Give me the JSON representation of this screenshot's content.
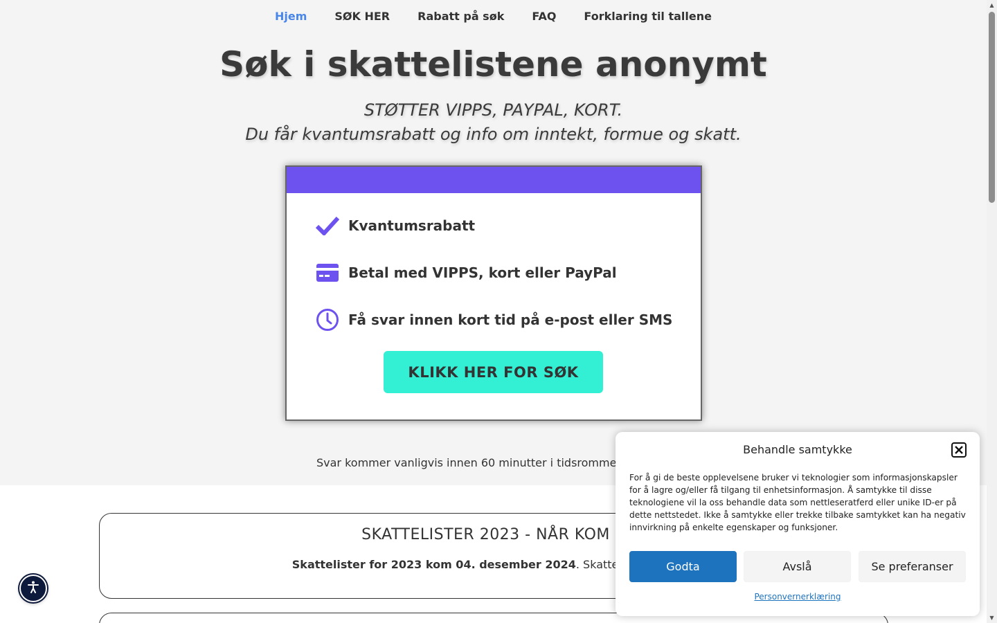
{
  "nav": {
    "items": [
      {
        "label": "Hjem",
        "active": true
      },
      {
        "label": "SØK HER"
      },
      {
        "label": "Rabatt på søk"
      },
      {
        "label": "FAQ"
      },
      {
        "label": "Forklaring til tallene"
      }
    ]
  },
  "hero": {
    "title": "Søk i skattelistene anonymt",
    "subtitle_line1": "STØTTER VIPPS, PAYPAL, KORT.",
    "subtitle_line2": "Du får kvantumsrabatt og info om inntekt, formue og skatt."
  },
  "card": {
    "accent_color": "#6d52ef",
    "features": [
      {
        "icon": "checkmark-icon",
        "label": "Kvantumsrabatt"
      },
      {
        "icon": "credit-card-icon",
        "label": "Betal med VIPPS, kort eller PayPal"
      },
      {
        "icon": "clock-icon",
        "label": "Få svar innen kort tid på e-post eller SMS"
      }
    ],
    "cta_label": "KLIKK HER FOR SØK",
    "cta_color": "#33efd3"
  },
  "answer_note": "Svar kommer vanligvis innen 60 minutter i tidsromme",
  "info": {
    "title": "SKATTELISTER 2023 - NÅR KOM D",
    "text_bold": "Skattelister for 2023 kom 04. desember 2024",
    "text_rest": ". Skattelister for 2024"
  },
  "consent": {
    "title": "Behandle samtykke",
    "body": "For å gi de beste opplevelsene bruker vi teknologier som informasjonskapsler for å lagre og/eller få tilgang til enhetsinformasjon. Å samtykke til disse teknologiene vil la oss behandle data som nettleseratferd eller unike ID-er på dette nettstedet. Ikke å samtykke eller trekke tilbake samtykket kan ha negativ innvirkning på enkelte egenskaper og funksjoner.",
    "accept_label": "Godta",
    "deny_label": "Avslå",
    "prefs_label": "Se preferanser",
    "privacy_link": "Personvernerklæring",
    "accept_color": "#1e73be"
  }
}
